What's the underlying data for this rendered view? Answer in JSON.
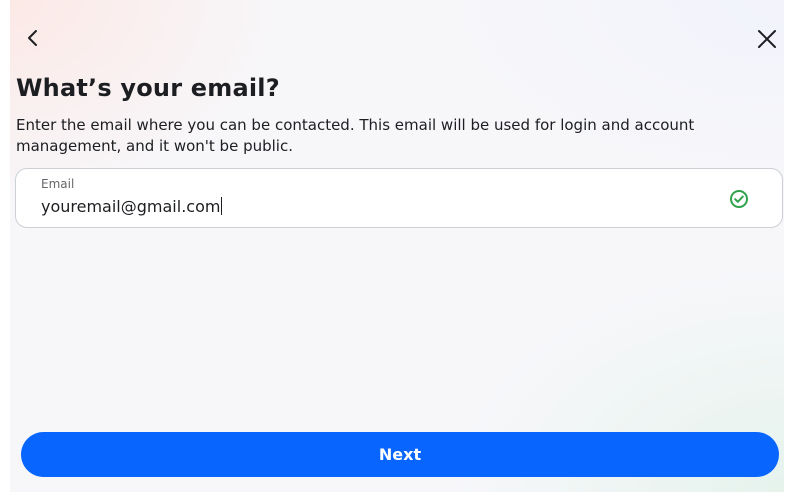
{
  "header": {
    "back_icon": "chevron-left-icon",
    "close_icon": "close-icon"
  },
  "main": {
    "title": "What’s your email?",
    "description": "Enter the email where you can be contacted. This email will be used for login and account management, and it won't be public."
  },
  "email_field": {
    "label": "Email",
    "value": "youremail@gmail.com",
    "status_icon": "check-circle-icon",
    "valid": true
  },
  "footer": {
    "next_label": "Next"
  },
  "colors": {
    "primary": "#0866ff",
    "success": "#31a24c",
    "text": "#1c1e21",
    "secondary_text": "#65676b"
  }
}
